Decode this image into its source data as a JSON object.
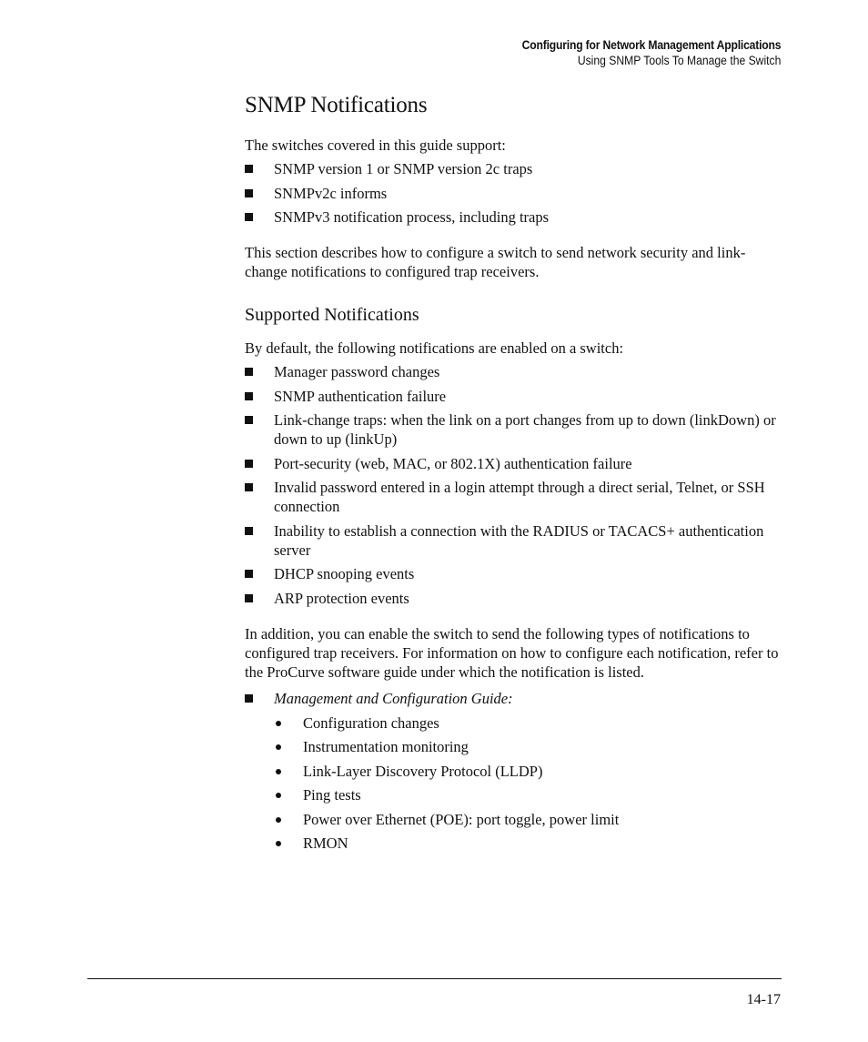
{
  "header": {
    "chapter": "Configuring for Network Management Applications",
    "section": "Using SNMP Tools To Manage the Switch"
  },
  "main": {
    "title": "SNMP Notifications",
    "intro": "The switches covered in this guide support:",
    "support_items": [
      "SNMP version 1 or SNMP version 2c traps",
      "SNMPv2c informs",
      "SNMPv3 notification process, including traps"
    ],
    "description": "This section describes how to configure a switch to send network security and link-change notifications to configured trap receivers.",
    "subsection": {
      "title": "Supported Notifications",
      "intro": "By default, the following notifications are enabled on a switch:",
      "default_items": [
        "Manager password changes",
        "SNMP authentication failure",
        "Link-change traps: when the link on a port changes from up to down (linkDown) or down to up (linkUp)",
        "Port-security (web, MAC, or 802.1X) authentication failure",
        "Invalid password entered in a login attempt through a direct serial, Telnet, or SSH connection",
        "Inability to establish a connection with the RADIUS or TACACS+ authentication server",
        "DHCP snooping events",
        "ARP protection events"
      ],
      "additional_intro": "In addition, you can enable the switch to send the following types of notifications to configured trap receivers. For information on how to configure each notification, refer to the ProCurve software guide under which the notification is listed.",
      "guides": [
        {
          "name": "Management and Configuration Guide:",
          "items": [
            "Configuration changes",
            "Instrumentation monitoring",
            "Link-Layer Discovery Protocol (LLDP)",
            "Ping tests",
            "Power over Ethernet (POE): port toggle, power limit",
            "RMON"
          ]
        }
      ]
    }
  },
  "footer": {
    "page_number": "14-17"
  }
}
